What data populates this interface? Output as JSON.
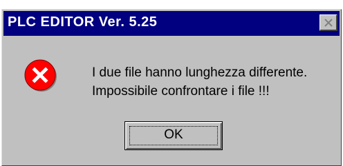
{
  "window": {
    "title": "PLC EDITOR Ver. 5.25",
    "close_icon": "close-icon"
  },
  "dialog": {
    "icon": "error-icon",
    "message_line1": "I due file hanno lunghezza differente.",
    "message_line2": "Impossibile confrontare i file !!!",
    "ok_label": "OK"
  },
  "colors": {
    "titlebar": "#000080",
    "face": "#c0c0c0",
    "error_red": "#ff0000"
  }
}
